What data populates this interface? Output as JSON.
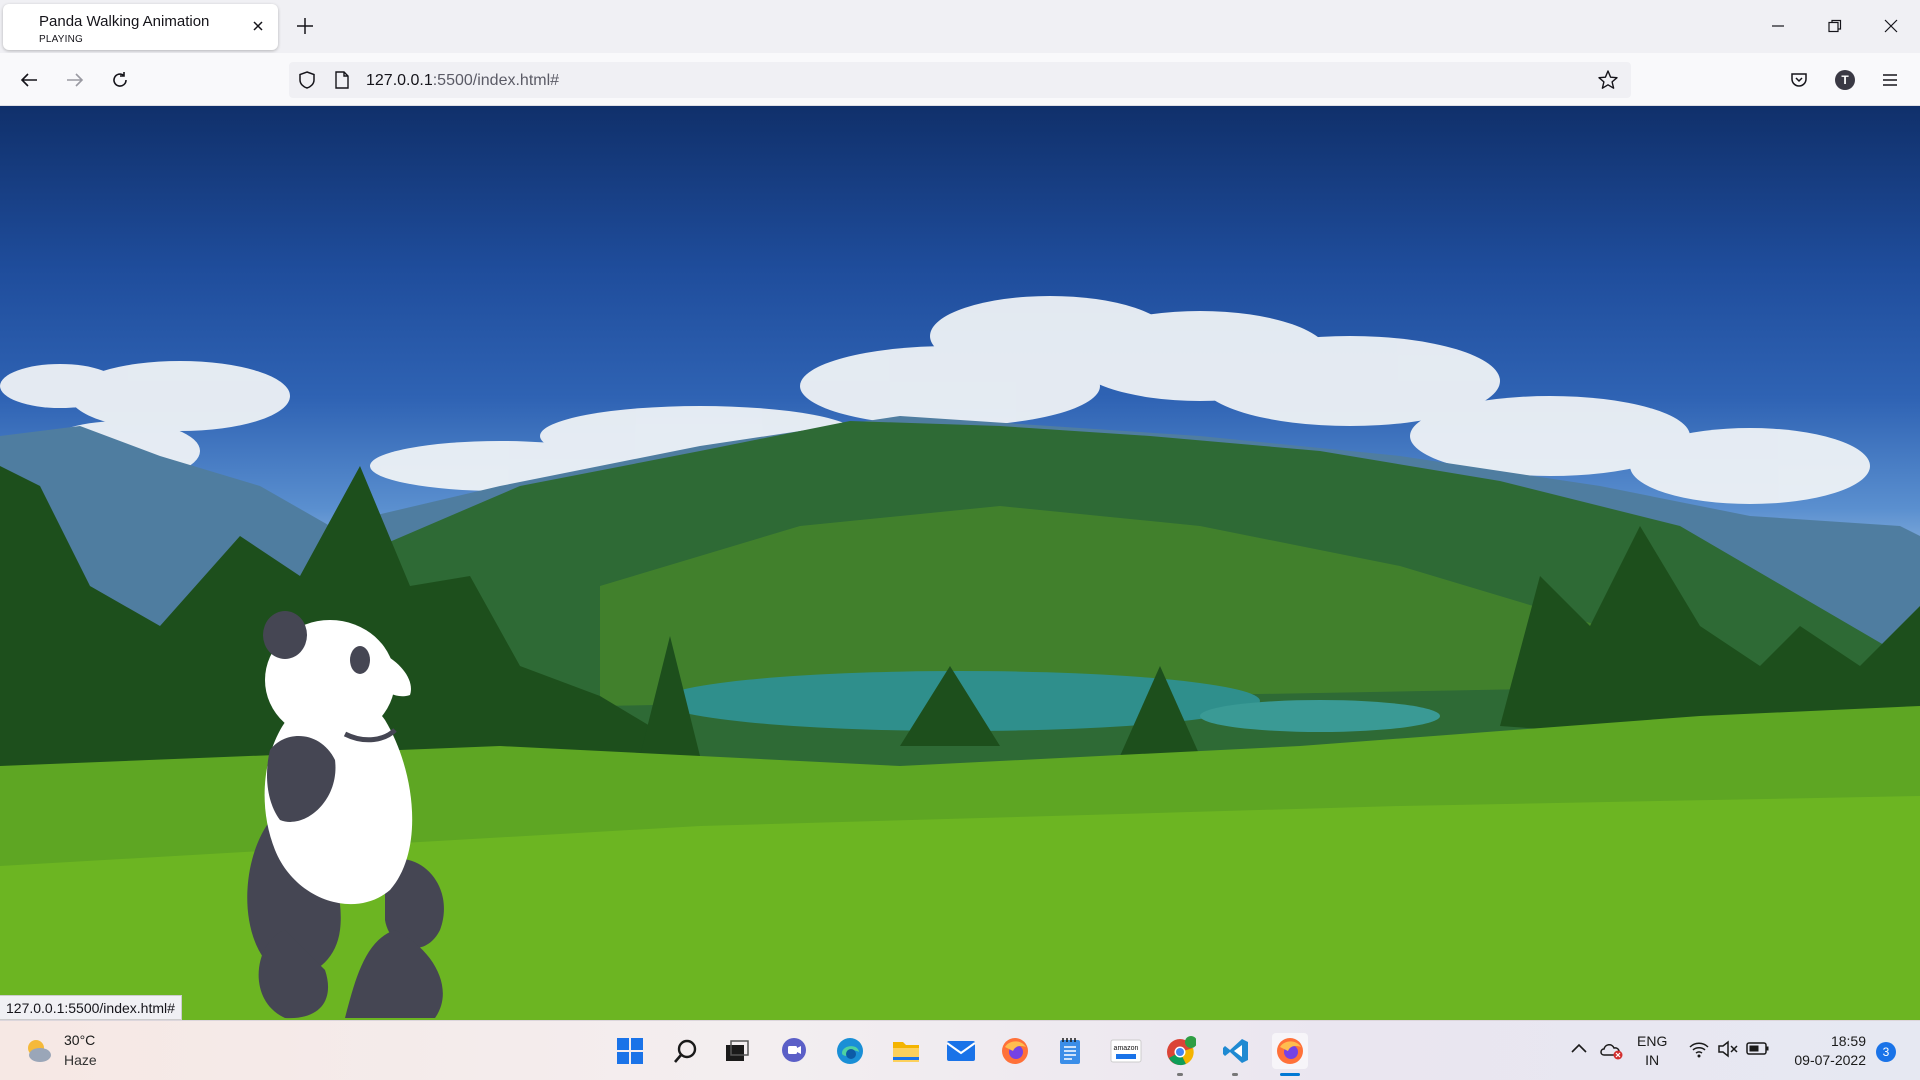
{
  "browser": {
    "tab": {
      "title": "Panda Walking Animation",
      "subtitle": "PLAYING"
    },
    "address": {
      "host": "127.0.0.1",
      "rest": ":5500/index.html#"
    },
    "profile_initial": "T",
    "status_url": "127.0.0.1:5500/index.html#"
  },
  "taskbar": {
    "weather": {
      "temp": "30°C",
      "desc": "Haze"
    },
    "lang": {
      "line1": "ENG",
      "line2": "IN"
    },
    "clock": {
      "time": "18:59",
      "date": "09-07-2022"
    },
    "notifications": "3",
    "apps": [
      "start-icon",
      "search-icon",
      "task-view-icon",
      "chat-icon",
      "edge-icon",
      "file-explorer-icon",
      "mail-icon",
      "firefox-icon",
      "notepad-icon",
      "amazon-icon",
      "chrome-icon",
      "vscode-icon",
      "firefox-active-icon"
    ]
  },
  "colors": {
    "accent": "#0078d4",
    "panda_dark": "#454653"
  }
}
